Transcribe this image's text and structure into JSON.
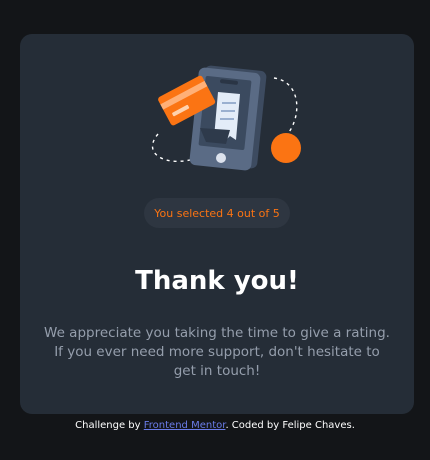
{
  "card": {
    "illustration_name": "payment-phone-illustration",
    "selection_text": "You selected 4 out of 5",
    "title": "Thank you!",
    "message": "We appreciate you taking the time to give a rating. If you ever need more support, don't hesitate to get in touch!"
  },
  "attribution": {
    "prefix": "Challenge by",
    "link_text": "Frontend Mentor",
    "suffix": ". Coded by Felipe Chaves."
  },
  "colors": {
    "background": "#131518",
    "card": "#252d37",
    "accent": "#fb7413",
    "text_muted": "#959eac",
    "link": "#6a7ce8"
  }
}
